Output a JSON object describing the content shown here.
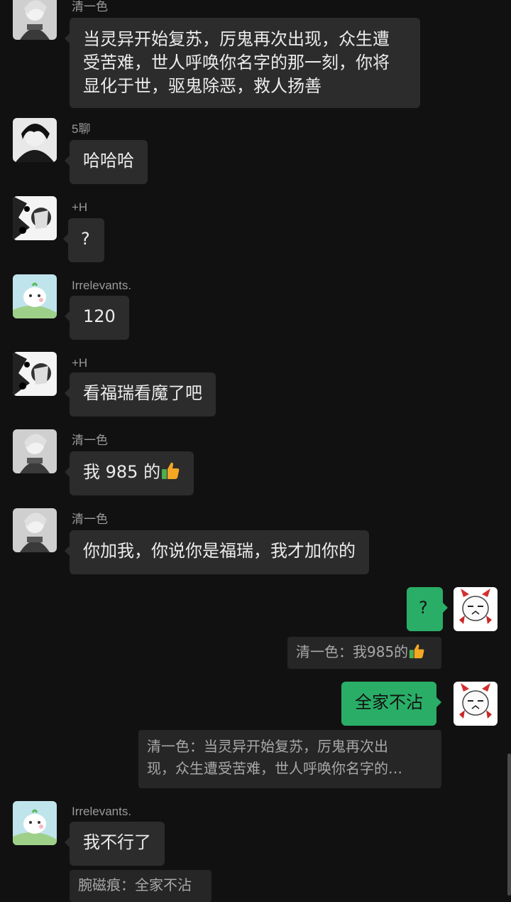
{
  "messages": [
    {
      "sender": "清一色",
      "lines": [
        "当灵异开始复苏，厉鬼再次出现，众生遭",
        "受苦难，世人呼唤你名字的那一刻，你将",
        "显化于世，驱鬼除恶，救人扬善"
      ]
    },
    {
      "sender": "5聊",
      "text": "哈哈哈"
    },
    {
      "sender": "+H",
      "text": "?"
    },
    {
      "sender": "Irrelevants.",
      "text": "120"
    },
    {
      "sender": "+H",
      "text": "看福瑞看魔了吧"
    },
    {
      "sender": "清一色",
      "text": "我 985 的",
      "emoji": "thumbs-up-icon"
    },
    {
      "sender": "清一色",
      "text": "你加我，你说你是福瑞，我才加你的"
    },
    {
      "sender": "me",
      "text": "?",
      "quote": "清一色：我985的",
      "quote_emoji": "thumbs-up-icon"
    },
    {
      "sender": "me",
      "text": "全家不沾",
      "quote_lines": [
        "清一色：当灵异开始复苏，厉鬼再次出",
        "现，众生遭受苦难，世人呼唤你名字的…"
      ]
    },
    {
      "sender": "Irrelevants.",
      "text": "我不行了",
      "quote": "腕磁痕：全家不沾"
    }
  ],
  "colors": {
    "background": "#111111",
    "bubble_incoming": "#2c2c2c",
    "bubble_outgoing": "#2aae67",
    "quote_bg": "#262626"
  }
}
